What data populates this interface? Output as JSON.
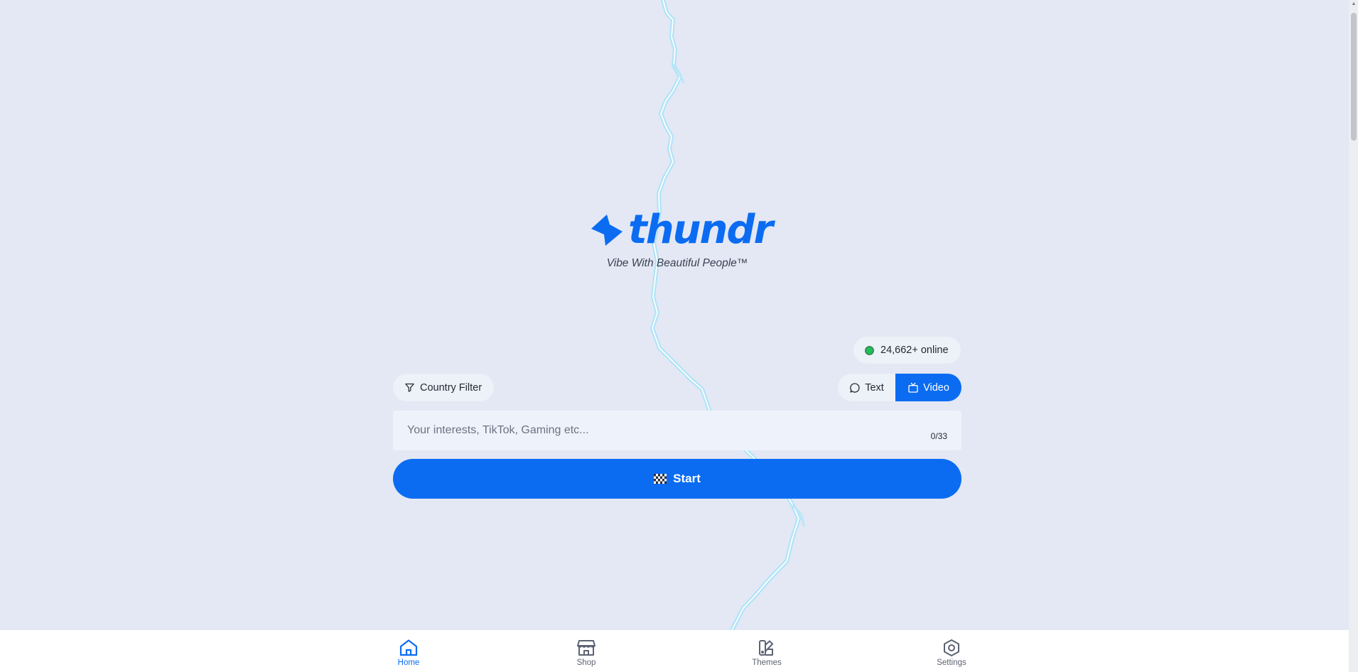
{
  "brand": {
    "name": "thundr",
    "tagline": "Vibe With Beautiful People™",
    "accent_color": "#0b6cf2"
  },
  "status": {
    "online_text": "24,662+ online",
    "online_color": "#21c15a"
  },
  "filters": {
    "country_filter_label": "Country Filter",
    "country_filter_icon": "filter-icon"
  },
  "mode": {
    "text_label": "Text",
    "text_icon": "chat-bubble-icon",
    "video_label": "Video",
    "video_icon": "tv-icon",
    "selected": "Video"
  },
  "interests": {
    "placeholder": "Your interests, TikTok, Gaming etc...",
    "value": "",
    "char_count": "0/33"
  },
  "start": {
    "label": "Start",
    "icon": "checkered-flag-icon"
  },
  "nav": {
    "items": [
      {
        "label": "Home",
        "icon": "home-icon",
        "active": true
      },
      {
        "label": "Shop",
        "icon": "shop-icon",
        "active": false
      },
      {
        "label": "Themes",
        "icon": "themes-icon",
        "active": false
      },
      {
        "label": "Settings",
        "icon": "settings-icon",
        "active": false
      }
    ]
  }
}
